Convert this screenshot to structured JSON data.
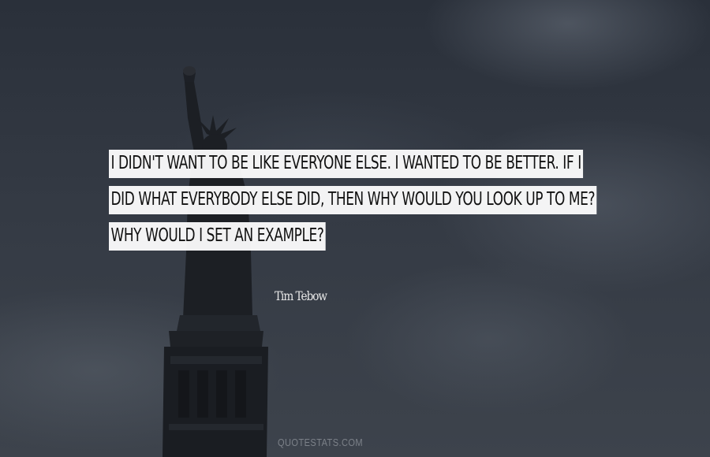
{
  "quote": {
    "lines": [
      "I DIDN'T WANT TO BE LIKE EVERYONE ELSE. I WANTED TO BE BETTER. IF I",
      "DID WHAT EVERYBODY ELSE DID, THEN WHY WOULD YOU LOOK UP TO ME?",
      "WHY WOULD I SET AN EXAMPLE?"
    ],
    "author": "Tim Tebow"
  },
  "watermark": "QUOTESTATS.COM",
  "colors": {
    "sky": "#2b313b",
    "statue": "#1c1f24",
    "quote_bg": "#ffffff",
    "quote_text": "#111111",
    "author_text": "#e8e8e8"
  }
}
